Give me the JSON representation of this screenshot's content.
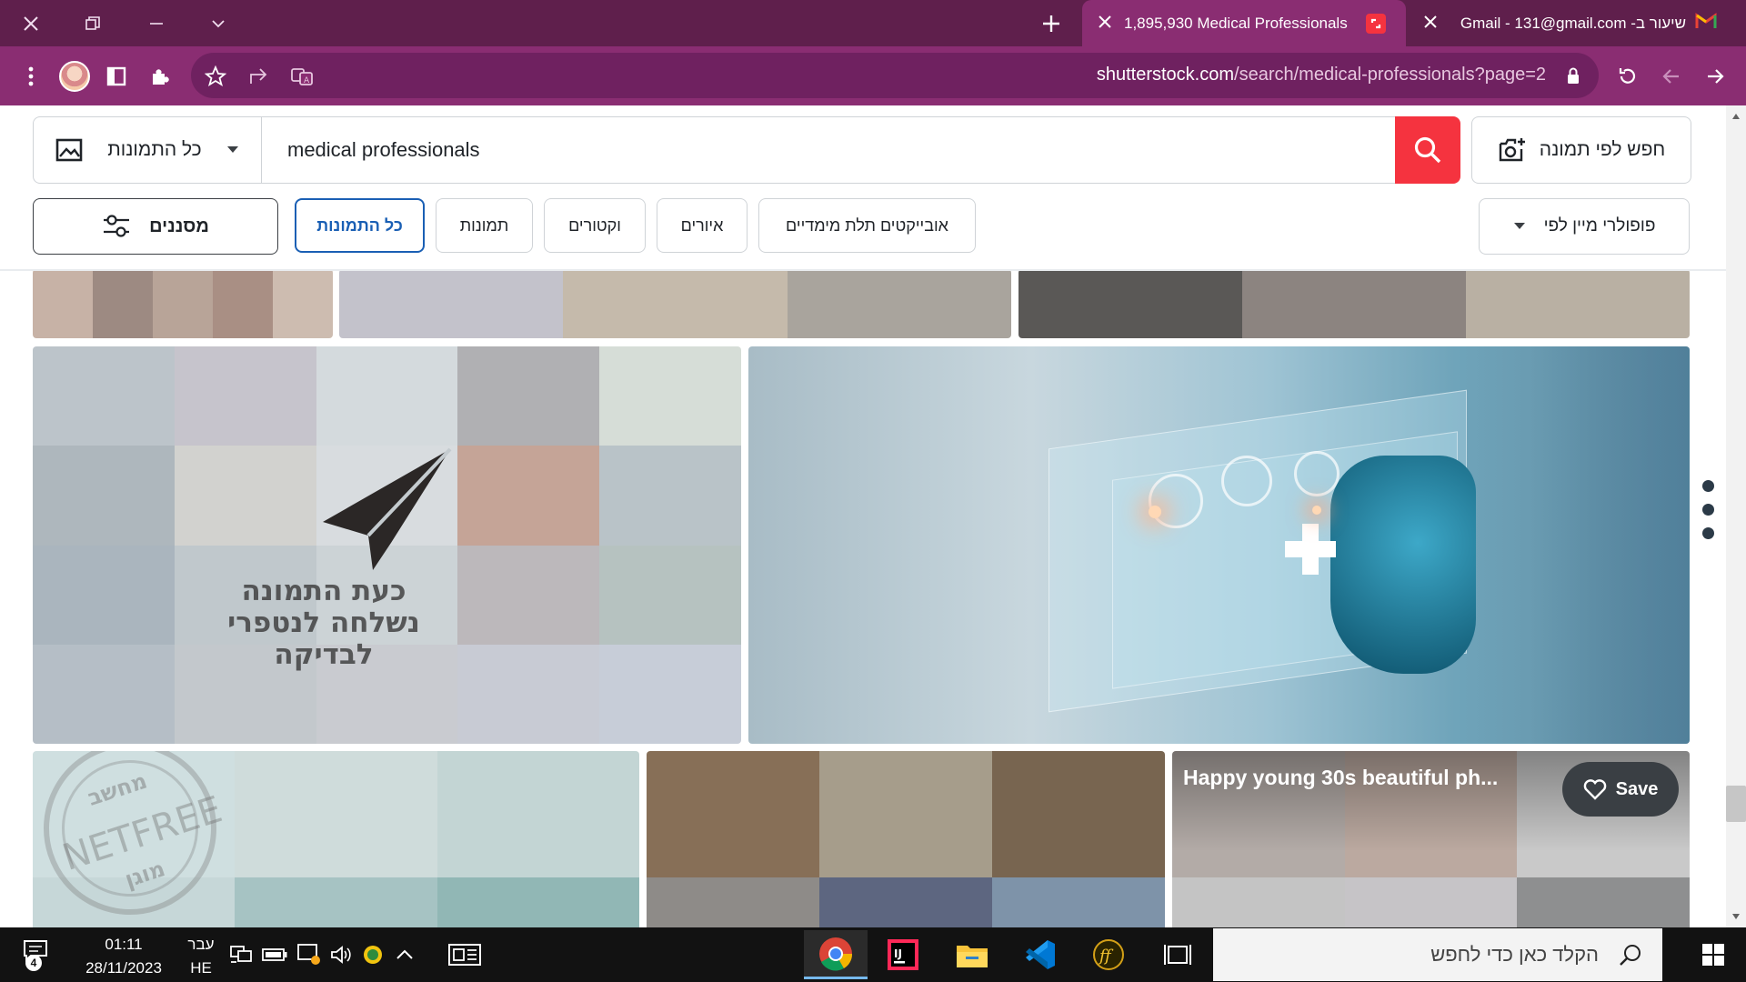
{
  "browser": {
    "tabs": [
      {
        "title": "1,895,930 Medical Professionals",
        "active": true
      },
      {
        "title": "שיעור ב- Gmail - 131@gmail.com",
        "active": false
      }
    ],
    "url_host": "shutterstock.com",
    "url_path": "/search/medical-professionals?page=2",
    "accent_tabstrip": "#5f1f4c",
    "accent_toolbar": "#8a2d72"
  },
  "search": {
    "type_select_label": "כל התמונות",
    "query": "medical professionals",
    "image_search_label": "חפש לפי תמונה"
  },
  "filters": {
    "filters_button_label": "מסננים",
    "chips": [
      {
        "label": "כל התמונות",
        "active": true
      },
      {
        "label": "תמונות",
        "active": false
      },
      {
        "label": "וקטורים",
        "active": false
      },
      {
        "label": "איורים",
        "active": false
      },
      {
        "label": "אובייקטים תלת מימדיים",
        "active": false
      }
    ],
    "sort_label": "מיין לפי",
    "sort_value": "פופולרי"
  },
  "grid": {
    "blocked_text_line1": "כעת התמונה",
    "blocked_text_line2": "נשלחה לנטפרי",
    "blocked_text_line3": "לבדיקה",
    "netfree_stamp_top": "מחשב",
    "netfree_stamp_middle": "NETFREE",
    "netfree_stamp_bottom": "מוגן",
    "hover_caption": "Happy young 30s beautiful ph...",
    "save_button_label": "Save"
  },
  "taskbar": {
    "search_placeholder": "הקלד כאן כדי לחפש",
    "language_top": "עבר",
    "language_bottom": "HE",
    "time": "01:11",
    "date": "28/11/2023",
    "notification_count": "4"
  }
}
